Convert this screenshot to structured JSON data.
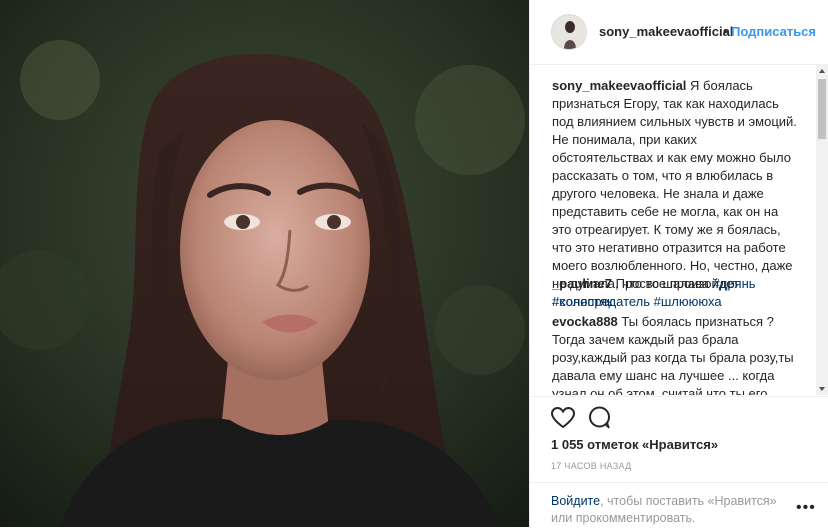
{
  "post": {
    "username": "sony_makeevaofficial",
    "dot": "•",
    "follow_label": "Подписаться"
  },
  "comments": [
    {
      "user": "sony_makeevaofficial",
      "text": "Я боялась признаться Егору, так как находилась под влиянием сильных чувств и эмоций. Не понимала, при каких обстоятельствах и как ему можно было рассказать о том, что я влюбилась в другого человека. Не знала и даже представить себе не могла, как он на это отреагирует. К тому же я боялась, что это негативно отразится на работе моего возлюбленного. Но, честно, даже не думала, что все произойдет",
      "tags": "#холостяк"
    },
    {
      "user": "_pauline7",
      "text": "Просто шалава",
      "tags": "#дрянь #соняпредатель #шлюююха"
    },
    {
      "user": "evocka888",
      "text": "Ты боялась признаться ?Тогда зачем каждый раз брала розу,каждый раз когда ты брала розу,ты давала ему шанс на лучшее ... когда узнал он об этом ,считай что ты его разбила изнутри"
    }
  ],
  "actions": {
    "likes": "1 055 отметок «Нравится»",
    "time": "17 ЧАСОВ НАЗАД"
  },
  "login": {
    "link": "Войдите",
    "rest": ", чтобы поставить «Нравится» или прокомментировать.",
    "more": "•••"
  },
  "icons": {
    "like": "heart-icon",
    "comment": "comment-bubble-icon",
    "more": "more-options-icon"
  }
}
